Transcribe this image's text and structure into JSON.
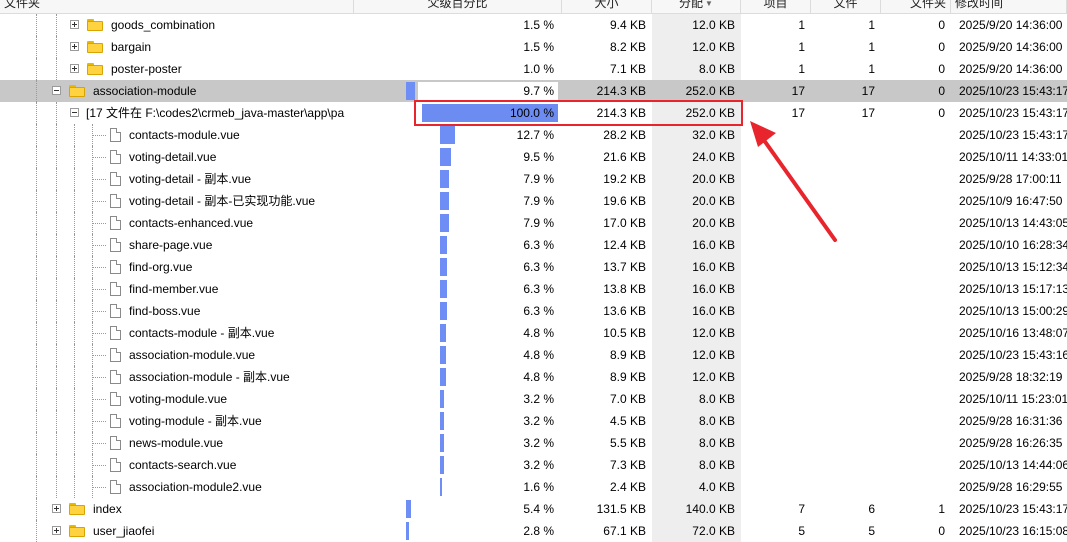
{
  "header": {
    "col_folder": "文件夹",
    "col_parent_pct": "父级百分比",
    "col_size": "大小",
    "col_allocated": "分配",
    "col_items": "项目",
    "col_files": "文件",
    "col_subfolders": "文件夹",
    "col_modified": "修改时间"
  },
  "colors": {
    "bar": "#6f8ef5",
    "selected_row": "#c8c8c8",
    "allocated_column": "#eeeeee",
    "highlight": "#e8242c"
  },
  "rows": [
    {
      "type": "folder",
      "indent": 1,
      "toggle": "plus",
      "name": "goods_combination",
      "parent_bar": 1.5,
      "pct": "1.5 %",
      "pct_value": 1.5,
      "size": "9.4 KB",
      "alloc": "12.0 KB",
      "items": "1",
      "files": "1",
      "folders": "0",
      "modified": "2025/9/20 14:36:00"
    },
    {
      "type": "folder",
      "indent": 1,
      "toggle": "plus",
      "name": "bargain",
      "parent_bar": 1.5,
      "pct": "1.5 %",
      "pct_value": 1.5,
      "size": "8.2 KB",
      "alloc": "12.0 KB",
      "items": "1",
      "files": "1",
      "folders": "0",
      "modified": "2025/9/20 14:36:00"
    },
    {
      "type": "folder",
      "indent": 1,
      "toggle": "plus",
      "name": "poster-poster",
      "parent_bar": 1.0,
      "pct": "1.0 %",
      "pct_value": 1.0,
      "size": "7.1 KB",
      "alloc": "8.0 KB",
      "items": "1",
      "files": "1",
      "folders": "0",
      "modified": "2025/9/20 14:36:00"
    },
    {
      "type": "folder",
      "indent": 0,
      "toggle": "minus",
      "selected": true,
      "name": "association-module",
      "parent_bar": 9.7,
      "pct": "9.7 %",
      "pct_value": 9.7,
      "size": "214.3 KB",
      "alloc": "252.0 KB",
      "items": "17",
      "files": "17",
      "folders": "0",
      "modified": "2025/10/23 15:43:17"
    },
    {
      "type": "group",
      "indent": 1,
      "toggle": "minus",
      "name": "[17 文件在 F:\\codes2\\crmeb_java-master\\app\\pa",
      "pct": "100.0 %",
      "pct_value": 100.0,
      "size": "214.3 KB",
      "alloc": "252.0 KB",
      "items": "17",
      "files": "17",
      "folders": "0",
      "modified": "2025/10/23 15:43:17"
    },
    {
      "type": "file",
      "indent": 2,
      "name": "contacts-module.vue",
      "pct": "12.7 %",
      "pct_value": 12.7,
      "size": "28.2 KB",
      "alloc": "32.0 KB",
      "items": "",
      "files": "",
      "folders": "",
      "modified": "2025/10/23 15:43:17"
    },
    {
      "type": "file",
      "indent": 2,
      "name": "voting-detail.vue",
      "pct": "9.5 %",
      "pct_value": 9.5,
      "size": "21.6 KB",
      "alloc": "24.0 KB",
      "items": "",
      "files": "",
      "folders": "",
      "modified": "2025/10/11 14:33:01"
    },
    {
      "type": "file",
      "indent": 2,
      "name": "voting-detail - 副本.vue",
      "pct": "7.9 %",
      "pct_value": 7.9,
      "size": "19.2 KB",
      "alloc": "20.0 KB",
      "items": "",
      "files": "",
      "folders": "",
      "modified": "2025/9/28 17:00:11"
    },
    {
      "type": "file",
      "indent": 2,
      "name": "voting-detail - 副本-已实现功能.vue",
      "pct": "7.9 %",
      "pct_value": 7.9,
      "size": "19.6 KB",
      "alloc": "20.0 KB",
      "items": "",
      "files": "",
      "folders": "",
      "modified": "2025/10/9 16:47:50"
    },
    {
      "type": "file",
      "indent": 2,
      "name": "contacts-enhanced.vue",
      "pct": "7.9 %",
      "pct_value": 7.9,
      "size": "17.0 KB",
      "alloc": "20.0 KB",
      "items": "",
      "files": "",
      "folders": "",
      "modified": "2025/10/13 14:43:05"
    },
    {
      "type": "file",
      "indent": 2,
      "name": "share-page.vue",
      "pct": "6.3 %",
      "pct_value": 6.3,
      "size": "12.4 KB",
      "alloc": "16.0 KB",
      "items": "",
      "files": "",
      "folders": "",
      "modified": "2025/10/10 16:28:34"
    },
    {
      "type": "file",
      "indent": 2,
      "name": "find-org.vue",
      "pct": "6.3 %",
      "pct_value": 6.3,
      "size": "13.7 KB",
      "alloc": "16.0 KB",
      "items": "",
      "files": "",
      "folders": "",
      "modified": "2025/10/13 15:12:34"
    },
    {
      "type": "file",
      "indent": 2,
      "name": "find-member.vue",
      "pct": "6.3 %",
      "pct_value": 6.3,
      "size": "13.8 KB",
      "alloc": "16.0 KB",
      "items": "",
      "files": "",
      "folders": "",
      "modified": "2025/10/13 15:17:13"
    },
    {
      "type": "file",
      "indent": 2,
      "name": "find-boss.vue",
      "pct": "6.3 %",
      "pct_value": 6.3,
      "size": "13.6 KB",
      "alloc": "16.0 KB",
      "items": "",
      "files": "",
      "folders": "",
      "modified": "2025/10/13 15:00:29"
    },
    {
      "type": "file",
      "indent": 2,
      "name": "contacts-module - 副本.vue",
      "pct": "4.8 %",
      "pct_value": 4.8,
      "size": "10.5 KB",
      "alloc": "12.0 KB",
      "items": "",
      "files": "",
      "folders": "",
      "modified": "2025/10/16 13:48:07"
    },
    {
      "type": "file",
      "indent": 2,
      "name": "association-module.vue",
      "pct": "4.8 %",
      "pct_value": 4.8,
      "size": "8.9 KB",
      "alloc": "12.0 KB",
      "items": "",
      "files": "",
      "folders": "",
      "modified": "2025/10/23 15:43:16"
    },
    {
      "type": "file",
      "indent": 2,
      "name": "association-module - 副本.vue",
      "pct": "4.8 %",
      "pct_value": 4.8,
      "size": "8.9 KB",
      "alloc": "12.0 KB",
      "items": "",
      "files": "",
      "folders": "",
      "modified": "2025/9/28 18:32:19"
    },
    {
      "type": "file",
      "indent": 2,
      "name": "voting-module.vue",
      "pct": "3.2 %",
      "pct_value": 3.2,
      "size": "7.0 KB",
      "alloc": "8.0 KB",
      "items": "",
      "files": "",
      "folders": "",
      "modified": "2025/10/11 15:23:01"
    },
    {
      "type": "file",
      "indent": 2,
      "name": "voting-module - 副本.vue",
      "pct": "3.2 %",
      "pct_value": 3.2,
      "size": "4.5 KB",
      "alloc": "8.0 KB",
      "items": "",
      "files": "",
      "folders": "",
      "modified": "2025/9/28 16:31:36"
    },
    {
      "type": "file",
      "indent": 2,
      "name": "news-module.vue",
      "pct": "3.2 %",
      "pct_value": 3.2,
      "size": "5.5 KB",
      "alloc": "8.0 KB",
      "items": "",
      "files": "",
      "folders": "",
      "modified": "2025/9/28 16:26:35"
    },
    {
      "type": "file",
      "indent": 2,
      "name": "contacts-search.vue",
      "pct": "3.2 %",
      "pct_value": 3.2,
      "size": "7.3 KB",
      "alloc": "8.0 KB",
      "items": "",
      "files": "",
      "folders": "",
      "modified": "2025/10/13 14:44:06"
    },
    {
      "type": "file",
      "indent": 2,
      "name": "association-module2.vue",
      "pct": "1.6 %",
      "pct_value": 1.6,
      "size": "2.4 KB",
      "alloc": "4.0 KB",
      "items": "",
      "files": "",
      "folders": "",
      "modified": "2025/9/28 16:29:55"
    },
    {
      "type": "folder",
      "indent": 0,
      "toggle": "plus",
      "name": "index",
      "parent_bar": 5.4,
      "pct": "5.4 %",
      "pct_value": 5.4,
      "size": "131.5 KB",
      "alloc": "140.0 KB",
      "items": "7",
      "files": "6",
      "folders": "1",
      "modified": "2025/10/23 15:43:17"
    },
    {
      "type": "folder",
      "indent": 0,
      "toggle": "plus",
      "name": "user_jiaofei",
      "parent_bar": 2.8,
      "pct": "2.8 %",
      "pct_value": 2.8,
      "size": "67.1 KB",
      "alloc": "72.0 KB",
      "items": "5",
      "files": "5",
      "folders": "0",
      "modified": "2025/10/23 16:15:08"
    }
  ]
}
